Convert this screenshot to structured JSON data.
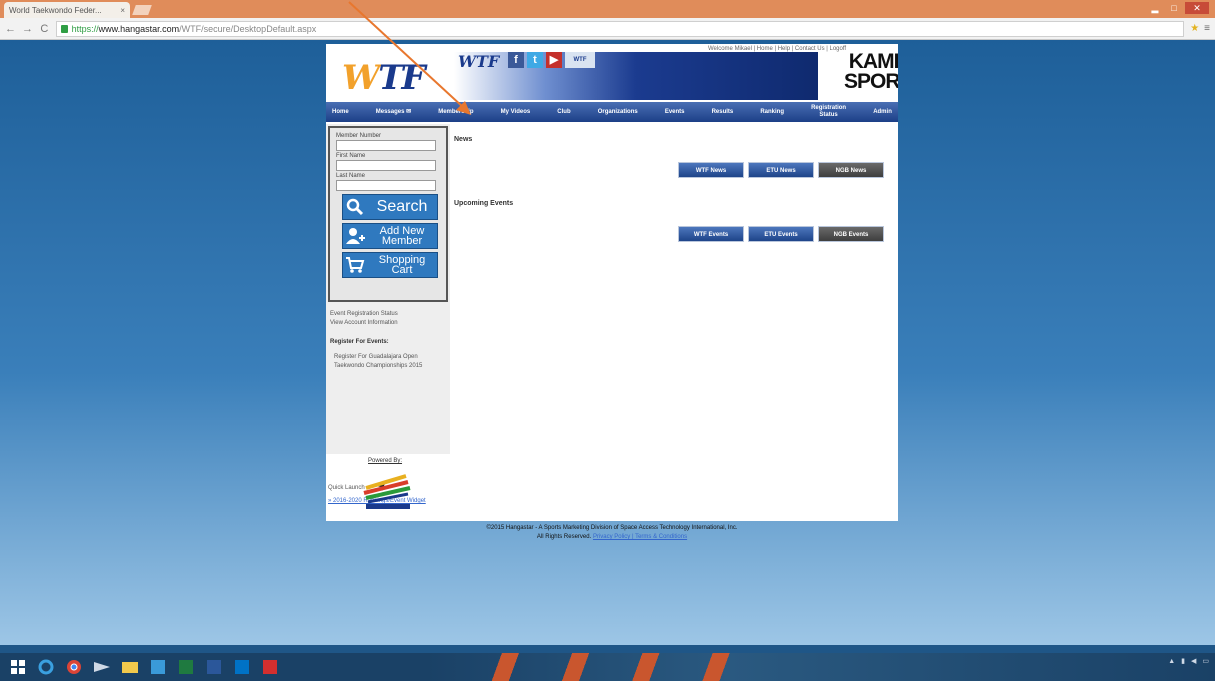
{
  "browser": {
    "tab_title": "World Taekwondo Feder...",
    "tab_close": "×",
    "url_scheme": "https://",
    "url_host": "www.hangastar.com",
    "url_path": "/WTF/secure/DesktopDefault.aspx",
    "back": "←",
    "forward": "→",
    "reload": "C",
    "minimize": "▂",
    "maximize": "□",
    "close": "✕",
    "star": "★",
    "menu": "≡"
  },
  "header": {
    "logo_w": "W",
    "logo_rest": "TF",
    "banner_logo": "WTF",
    "social": {
      "facebook": "f",
      "twitter": "t",
      "youtube": "▶",
      "other": "WTF"
    },
    "top_links": "Welcome Mikael | Home | Help | Contact Us | Logoff",
    "kamp_line1": "KAMP",
    "kamp_line2": "SPORT"
  },
  "nav": [
    {
      "line1": "Home",
      "line2": ""
    },
    {
      "line1": "Messages ✉",
      "line2": ""
    },
    {
      "line1": "Membership",
      "line2": ""
    },
    {
      "line1": "My Videos",
      "line2": ""
    },
    {
      "line1": "Club",
      "line2": ""
    },
    {
      "line1": "Organizations",
      "line2": ""
    },
    {
      "line1": "Events",
      "line2": ""
    },
    {
      "line1": "Results",
      "line2": ""
    },
    {
      "line1": "Ranking",
      "line2": ""
    },
    {
      "line1": "Registration",
      "line2": "Status"
    },
    {
      "line1": "Admin",
      "line2": ""
    }
  ],
  "sidebar": {
    "member_number_label": "Member Number",
    "first_name_label": "First Name",
    "last_name_label": "Last Name",
    "member_number_value": "",
    "first_name_value": "",
    "last_name_value": "",
    "search_label": "Search",
    "add_member_label": "Add New Member",
    "shopping_cart_label": "Shopping Cart",
    "link_event_status": "Event Registration Status",
    "link_account_info": "View Account Information",
    "register_heading": "Register For Events:",
    "register_item": "Register For Guadalajara Open Taekwondo Championships 2015",
    "quick_launch": "Quick Launch",
    "quick_ref": "» 2016-2020 Rankings/Event Widget",
    "powered_by": "Powered By:"
  },
  "main": {
    "news_title": "News",
    "news_buttons": [
      "WTF News",
      "ETU News",
      "NGB News"
    ],
    "events_title": "Upcoming Events",
    "events_buttons": [
      "WTF Events",
      "ETU Events",
      "NGB Events"
    ]
  },
  "footer": {
    "line1": "©2015 Hangastar - A Sports Marketing Division of Space Access Technology International, Inc.",
    "line2_prefix": "All Rights Reserved.",
    "line2_links": "Privacy Policy | Terms & Conditions"
  },
  "colors": {
    "accent_arrow": "#e8772e",
    "nav_blue": "#1c3f87",
    "button_blue": "#2f79bf"
  }
}
